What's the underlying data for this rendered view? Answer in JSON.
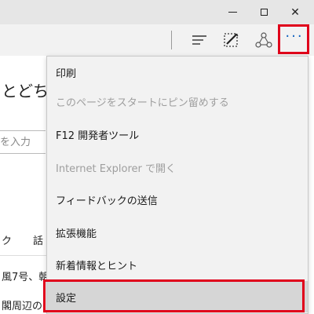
{
  "titlebar": {
    "minimize_icon": "minimize-icon",
    "maximize_icon": "maximize-icon",
    "close_glyph": "✕"
  },
  "toolbar": {
    "hub_icon": "hub-icon",
    "web_note_icon": "web-note-icon",
    "share_icon": "share-icon",
    "more_glyph": "···",
    "highlight_color": "#e0001b",
    "more_color": "#1565c0"
  },
  "background_page": {
    "heading": "とどちら",
    "search_placeholder": "を入力",
    "tabs": [
      "ク",
      "話"
    ],
    "news": [
      "風7号、朝",
      "閣周辺の"
    ]
  },
  "menu": {
    "items": [
      {
        "label": "印刷",
        "enabled": true
      },
      {
        "label": "このページをスタートにピン留めする",
        "enabled": false
      },
      {
        "label": "F12 開発者ツール",
        "enabled": true
      },
      {
        "label": "Internet Explorer で開く",
        "enabled": false
      },
      {
        "label": "フィードバックの送信",
        "enabled": true
      },
      {
        "label": "拡張機能",
        "enabled": true
      },
      {
        "label": "新着情報とヒント",
        "enabled": true
      },
      {
        "label": "設定",
        "enabled": true,
        "highlighted": true
      }
    ]
  }
}
